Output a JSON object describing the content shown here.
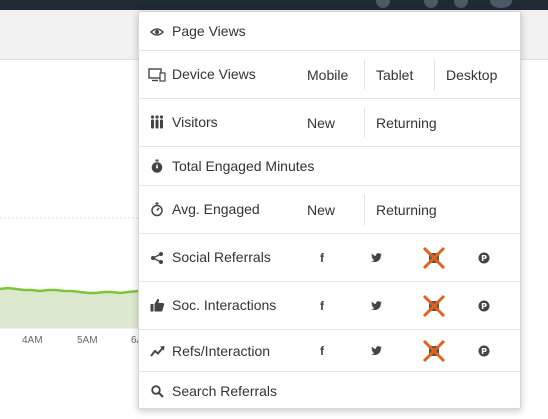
{
  "background": {
    "x_ticks": [
      "4AM",
      "5AM",
      "6A"
    ],
    "line_color": "#7ec43b",
    "fill_color": "#dde9cf"
  },
  "menu": {
    "items": [
      {
        "label": "Page Views",
        "icon": "eye-icon"
      },
      {
        "label": "Device Views",
        "icon": "devices-icon",
        "options": [
          "Mobile",
          "Tablet",
          "Desktop"
        ]
      },
      {
        "label": "Visitors",
        "icon": "people-icon",
        "options": [
          "New",
          "Returning"
        ]
      },
      {
        "label": "Total Engaged Minutes",
        "icon": "stopwatch-icon"
      },
      {
        "label": "Avg. Engaged",
        "icon": "timer-icon",
        "options": [
          "New",
          "Returning"
        ]
      },
      {
        "label": "Social Referrals",
        "icon": "share-icon",
        "networks": [
          "facebook",
          "twitter",
          "linkedin-disabled",
          "pinterest"
        ]
      },
      {
        "label": "Soc. Interactions",
        "icon": "thumbs-up-icon",
        "networks": [
          "facebook",
          "twitter",
          "linkedin-disabled",
          "pinterest"
        ]
      },
      {
        "label": "Refs/Interaction",
        "icon": "trend-icon",
        "networks": [
          "facebook",
          "twitter",
          "linkedin-disabled",
          "pinterest"
        ]
      },
      {
        "label": "Search Referrals",
        "icon": "search-icon"
      }
    ]
  },
  "glyphs": {
    "facebook": "f",
    "twitter": "🐦",
    "pinterest": "P"
  },
  "colors": {
    "disabled_x": "#e3621b",
    "icon": "#444444"
  }
}
